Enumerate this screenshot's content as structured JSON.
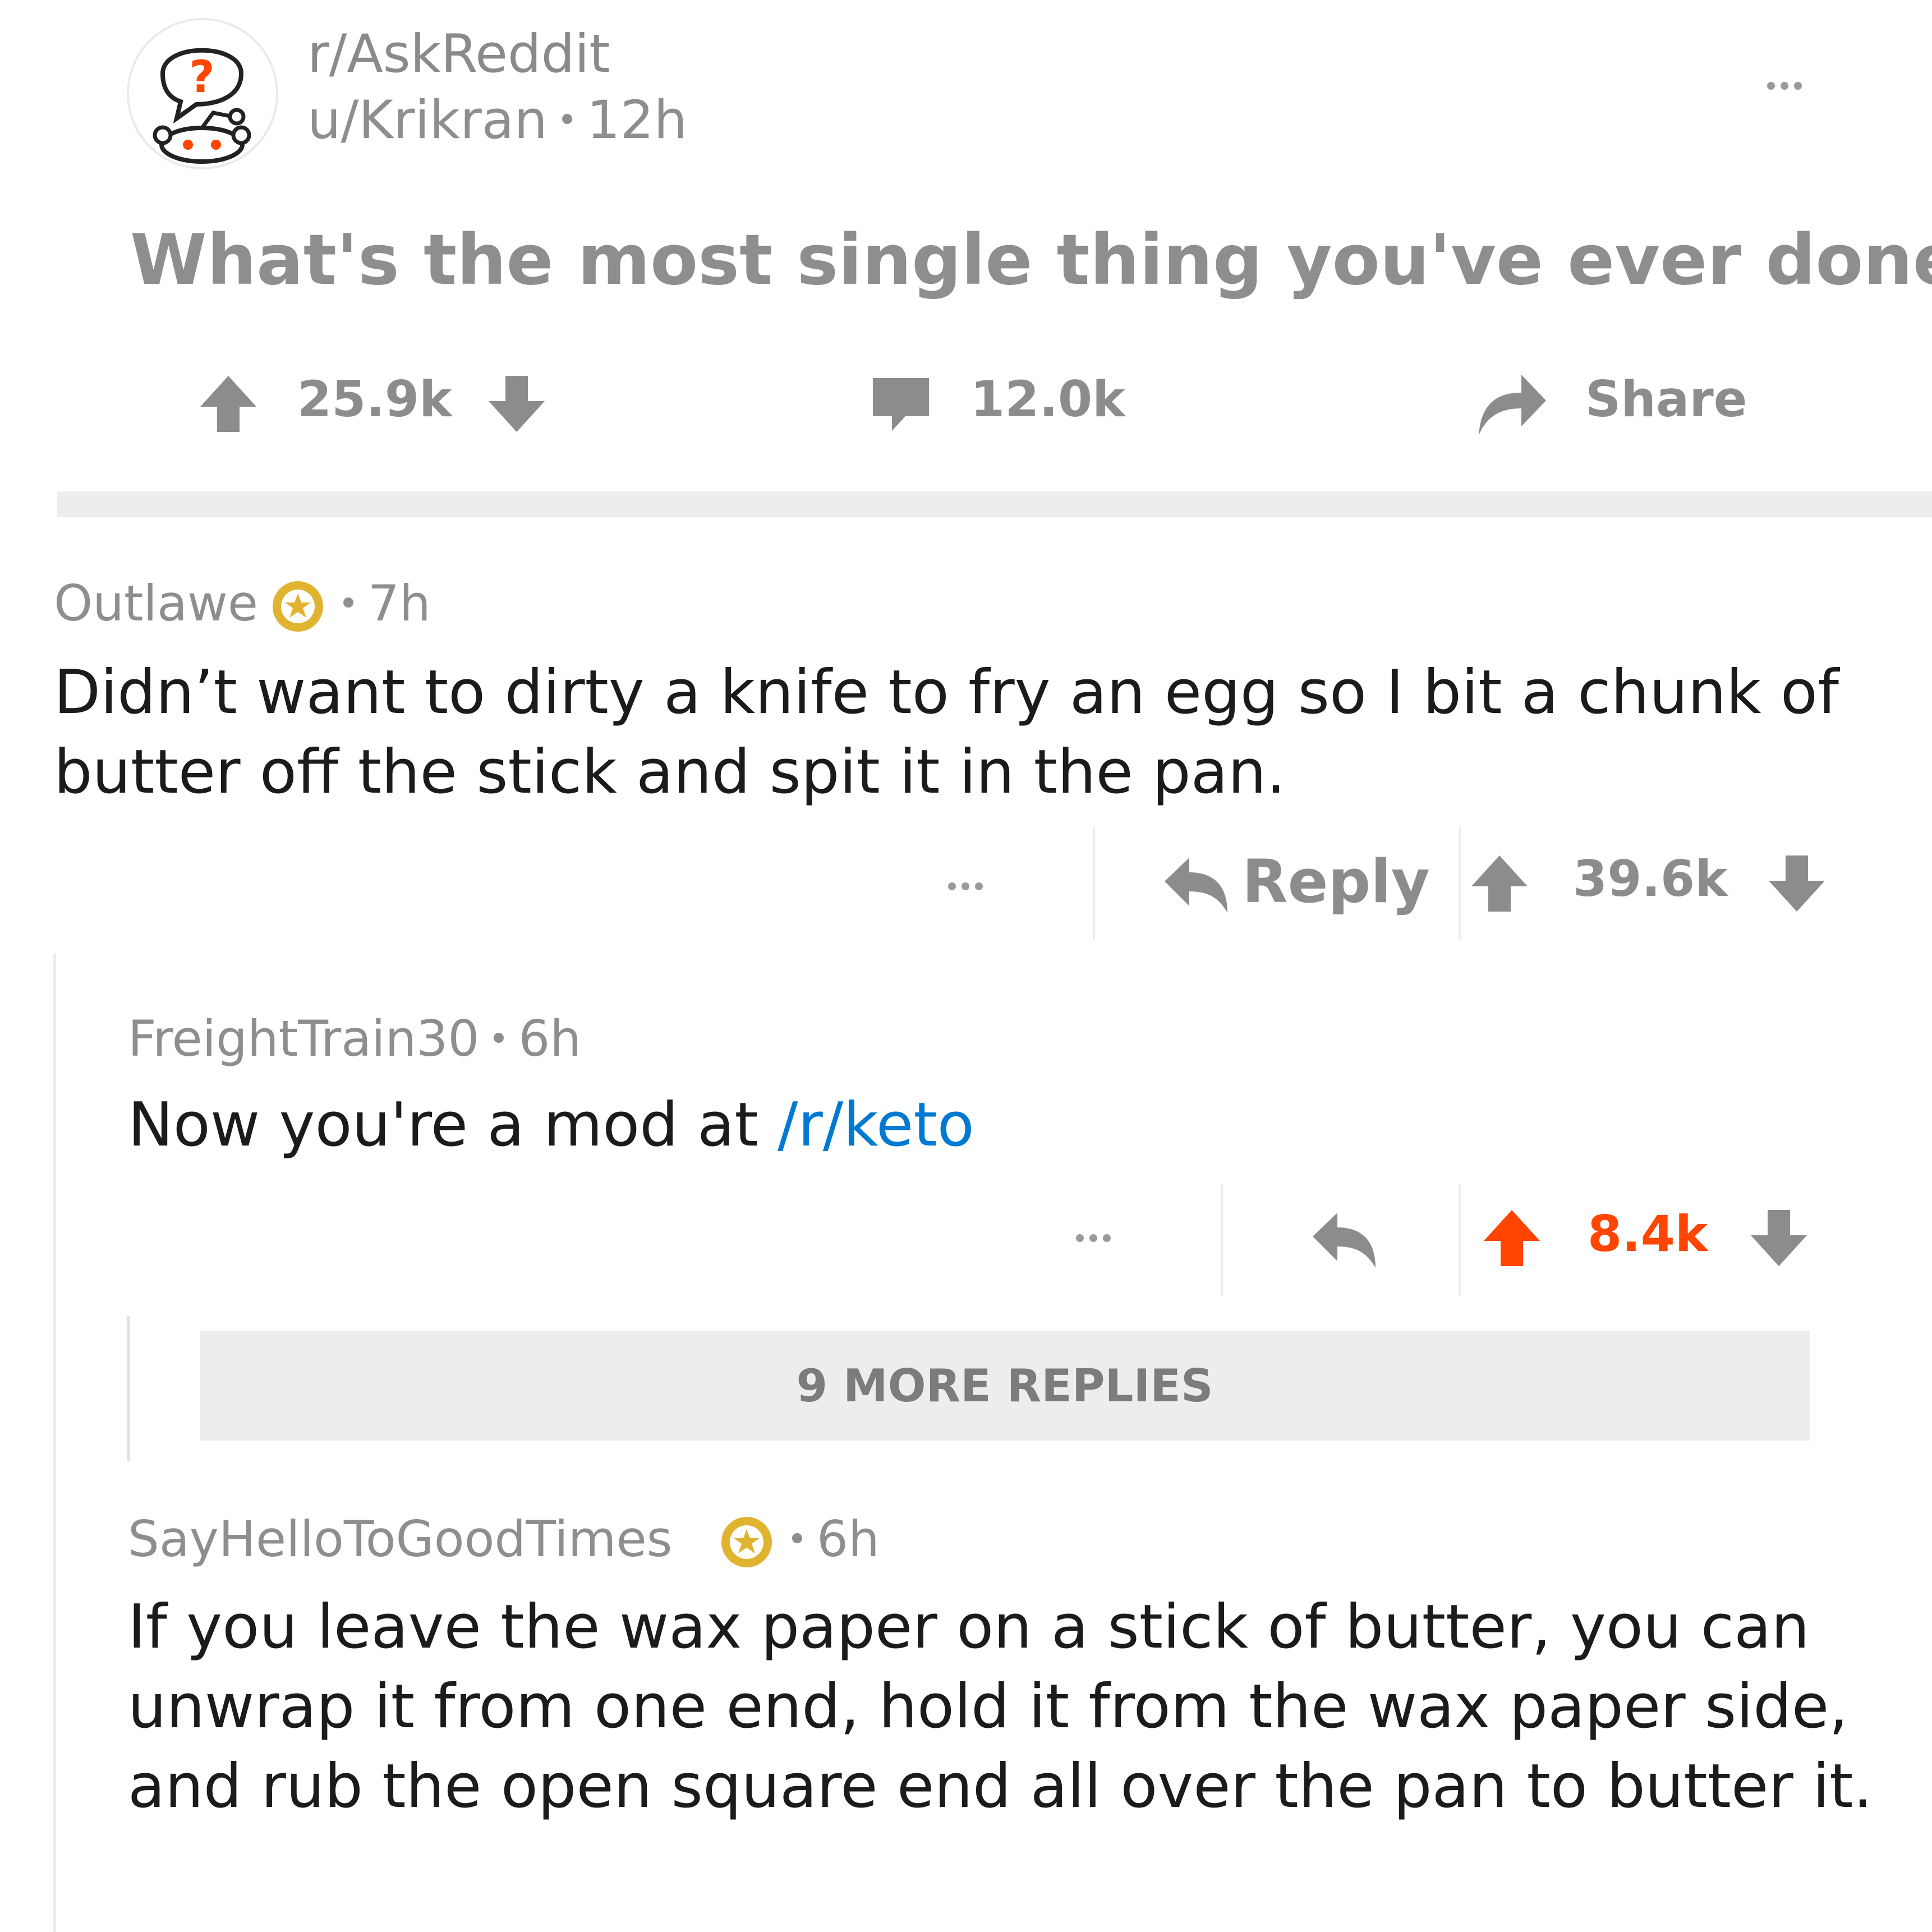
{
  "post": {
    "subreddit": "r/AskReddit",
    "author": "u/Krikran",
    "age": "12h",
    "title": "What's the most single thing you've ever done?",
    "upvotes": "25.9k",
    "comments": "12.0k",
    "share_label": "Share"
  },
  "comments": [
    {
      "author": "Outlawe",
      "age": "7h",
      "body": "Didn’t want to dirty a knife to fry an egg so I bit a chunk of butter off the stick and spit it in the pan.",
      "reply_label": "Reply",
      "score": "39.6k"
    },
    {
      "author": "FreightTrain30",
      "age": "6h",
      "body_prefix": "Now you're a mod at ",
      "body_link": "/r/keto",
      "score": "8.4k"
    },
    {
      "author": "SayHelloToGoodTimes",
      "age": "6h",
      "body": "If you leave the wax paper on a stick of butter, you can unwrap it from one end, hold it from the wax paper side, and rub the open square end all over the pan to butter it."
    }
  ],
  "more_replies_label": "9 MORE REPLIES",
  "colors": {
    "upvote_active": "#ff4500",
    "link": "#0079d3",
    "gold_badge": "#e0b430",
    "icon_gray": "#8c8c8c"
  }
}
